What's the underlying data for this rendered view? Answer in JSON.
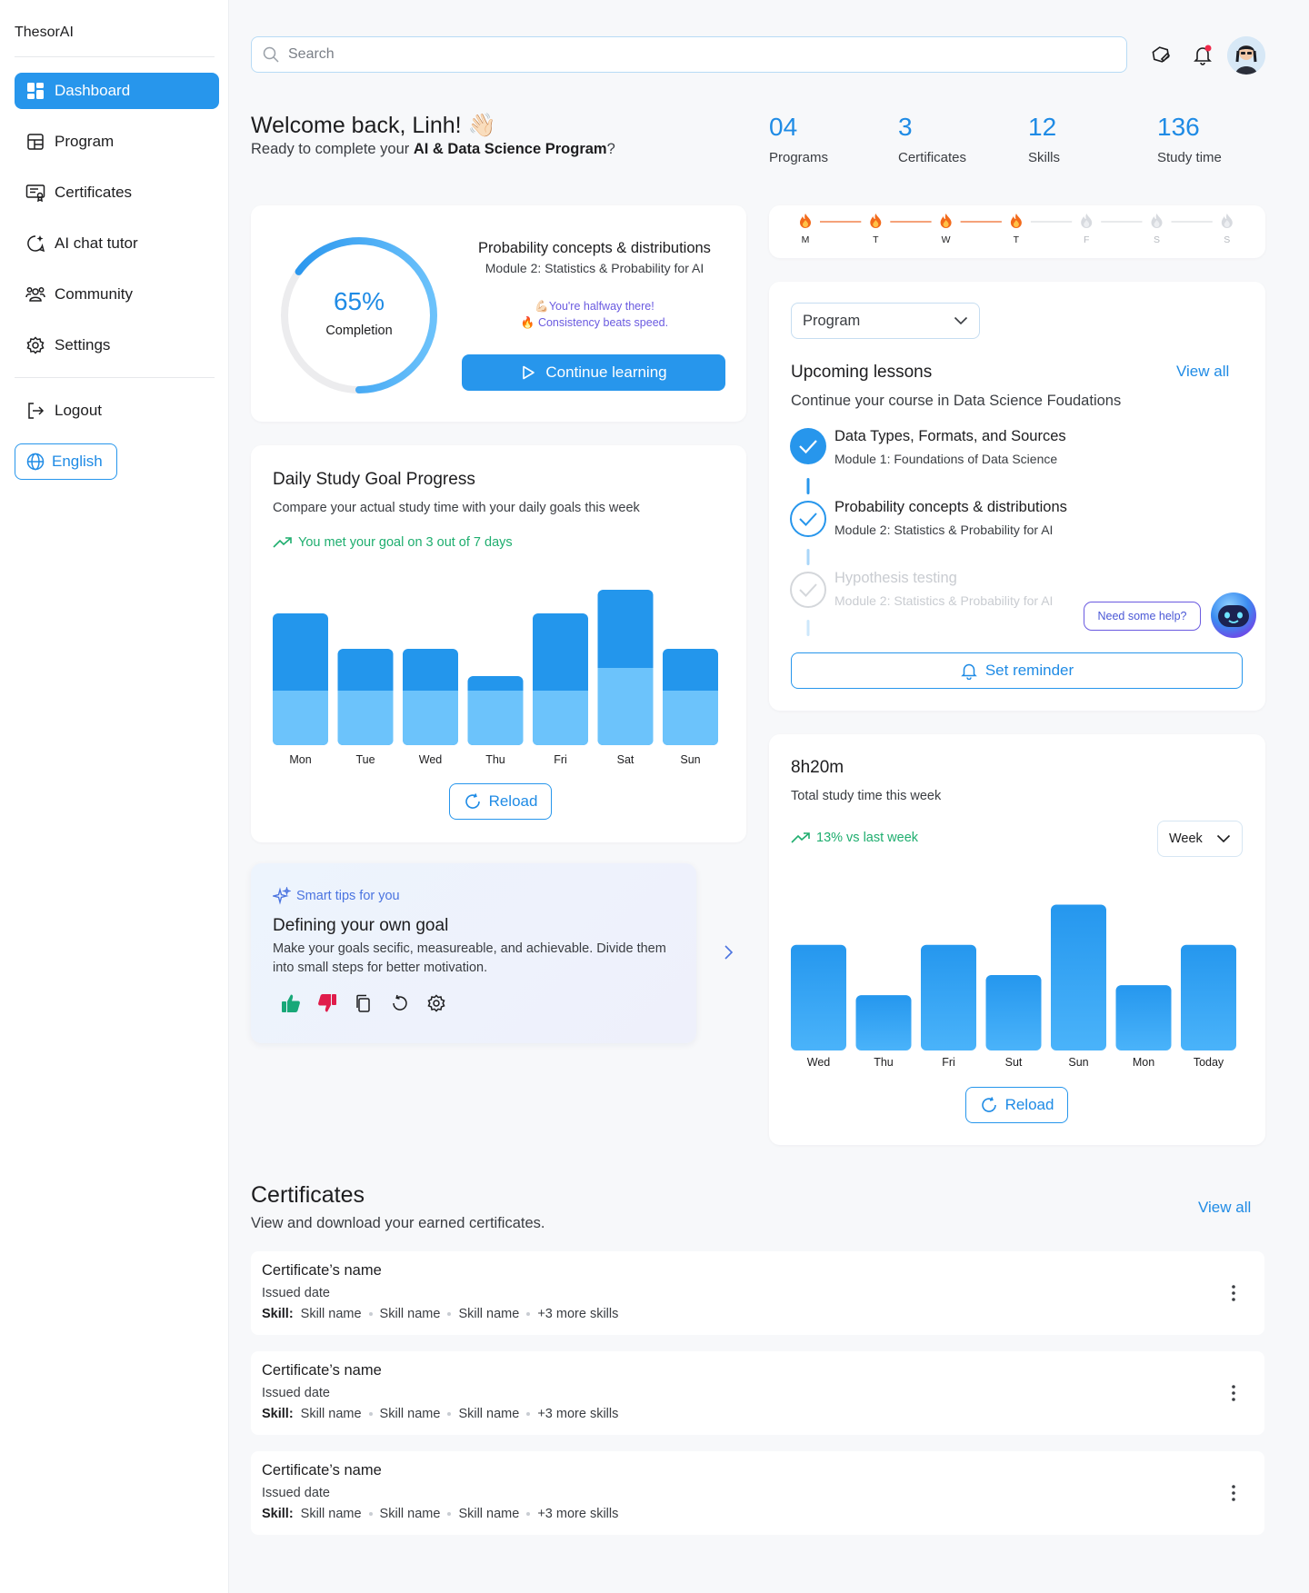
{
  "app": {
    "name": "ThesorAI"
  },
  "sidebar": {
    "items": [
      {
        "label": "Dashboard",
        "icon": "dashboard-icon"
      },
      {
        "label": "Program",
        "icon": "program-icon"
      },
      {
        "label": "Certificates",
        "icon": "certificate-icon"
      },
      {
        "label": "AI chat tutor",
        "icon": "ai-chat-icon"
      },
      {
        "label": "Community",
        "icon": "community-icon"
      },
      {
        "label": "Settings",
        "icon": "settings-icon"
      }
    ],
    "logout": "Logout",
    "language": "English"
  },
  "topbar": {
    "search_placeholder": "Search"
  },
  "welcome": {
    "title": "Welcome back, Linh! 👋🏻",
    "subtitle_prefix": "Ready to complete your ",
    "program": "AI & Data Science Program",
    "subtitle_suffix": "?"
  },
  "stats": [
    {
      "value": "04",
      "label": "Programs"
    },
    {
      "value": "3",
      "label": "Certificates"
    },
    {
      "value": "12",
      "label": "Skills"
    },
    {
      "value": "136",
      "label": "Study time"
    }
  ],
  "progress_card": {
    "percent_label": "65%",
    "percent_value": 65,
    "label": "Completion",
    "course_title": "Probability concepts & distributions",
    "course_module": "Module 2: Statistics & Probability for AI",
    "motivation_1": "💪🏻You're halfway there!",
    "motivation_2": "🔥 Consistency beats speed.",
    "button": "Continue learning"
  },
  "streak": {
    "days": [
      "M",
      "T",
      "W",
      "T",
      "F",
      "S",
      "S"
    ],
    "active": [
      true,
      true,
      true,
      true,
      false,
      false,
      false
    ]
  },
  "daily_goal": {
    "title": "Daily Study Goal Progress",
    "subtitle": "Compare your actual study time with your daily goals this week",
    "insight": "You met your goal on 3 out of 7 days",
    "reload": "Reload"
  },
  "lessons": {
    "select": "Program",
    "title": "Upcoming lessons",
    "view_all": "View all",
    "subtitle": "Continue your course in Data Science Foudations",
    "items": [
      {
        "title": "Data Types, Formats, and Sources",
        "module": "Module 1: Foundations of Data Science",
        "state": "done"
      },
      {
        "title": "Probability concepts & distributions",
        "module": "Module 2: Statistics & Probability for AI",
        "state": "current"
      },
      {
        "title": "Hypothesis testing",
        "module": "Module 2: Statistics & Probability for AI",
        "state": "locked"
      }
    ],
    "help": "Need some help?",
    "reminder": "Set reminder"
  },
  "study_time": {
    "total": "8h20m",
    "subtitle": "Total study time this week",
    "delta": "13% vs last week",
    "period": "Week",
    "reload": "Reload"
  },
  "tips": {
    "tag": "Smart tips for you",
    "title": "Defining your own goal",
    "body": "Make your goals secific, measureable, and achievable. Divide them into small steps for better motivation."
  },
  "certificates": {
    "title": "Certificates",
    "subtitle": "View and download your earned certificates.",
    "view_all": "View all",
    "skill_label": "Skill:",
    "items": [
      {
        "name": "Certificate’s name",
        "date": "Issued date",
        "skills": [
          "Skill name",
          "Skill name",
          "Skill name"
        ],
        "more": "+3 more skills"
      },
      {
        "name": "Certificate’s name",
        "date": "Issued date",
        "skills": [
          "Skill name",
          "Skill name",
          "Skill name"
        ],
        "more": "+3 more skills"
      },
      {
        "name": "Certificate’s name",
        "date": "Issued date",
        "skills": [
          "Skill name",
          "Skill name",
          "Skill name"
        ],
        "more": "+3 more skills"
      }
    ]
  },
  "chart_data": [
    {
      "type": "bar",
      "name": "daily-goal",
      "categories": [
        "Mon",
        "Tue",
        "Wed",
        "Thu",
        "Fri",
        "Sat",
        "Sun"
      ],
      "series": [
        {
          "values": [
            60,
            60,
            60,
            60,
            60,
            85,
            60
          ]
        },
        {
          "values": [
            145,
            106,
            106,
            76,
            145,
            171,
            106
          ]
        }
      ],
      "ylim": [
        0,
        180
      ],
      "colors": {
        "goal": "#6cc3fb",
        "actual": "#2396ec"
      }
    },
    {
      "type": "bar",
      "name": "study-time",
      "categories": [
        "Wed",
        "Thu",
        "Fri",
        "Sut",
        "Sun",
        "Mon",
        "Today"
      ],
      "values": [
        105,
        55,
        105,
        75,
        145,
        65,
        105
      ],
      "ylim": [
        0,
        150
      ],
      "colors": {
        "top": "#2597ee",
        "bottom": "#4ab3fa"
      }
    }
  ]
}
